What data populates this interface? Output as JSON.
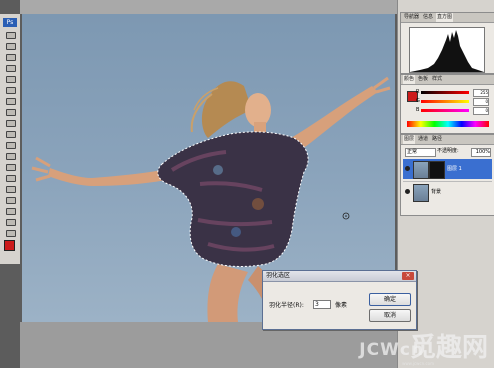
{
  "toolbar": {
    "logo": "Ps"
  },
  "panels": {
    "navigator_tabs": [
      "导航器",
      "信息",
      "直方图"
    ],
    "color_tabs": [
      "颜色",
      "色板",
      "样式"
    ],
    "color_values": [
      "255",
      "0",
      "0"
    ],
    "layers_tabs": [
      "图层",
      "通道",
      "路径"
    ],
    "layer_mode": "正常",
    "opacity_label": "不透明度:",
    "opacity_value": "100%",
    "layers": [
      {
        "name": "图层 1",
        "selected": true
      },
      {
        "name": "背景",
        "selected": false
      }
    ]
  },
  "dialog": {
    "title": "羽化选区",
    "close": "×",
    "radius_label": "羽化半径(R):",
    "radius_value": "3",
    "radius_unit": "像素",
    "ok_label": "确定",
    "cancel_label": "取消"
  },
  "watermark": {
    "latin": "JCWcn",
    "chinese": "觅趣网",
    "url": "www.jcwcn.com"
  },
  "colors": {
    "sky": "#8aa3bb",
    "foreground": "#cc1b1b",
    "selected_layer": "#3a6fd0"
  }
}
